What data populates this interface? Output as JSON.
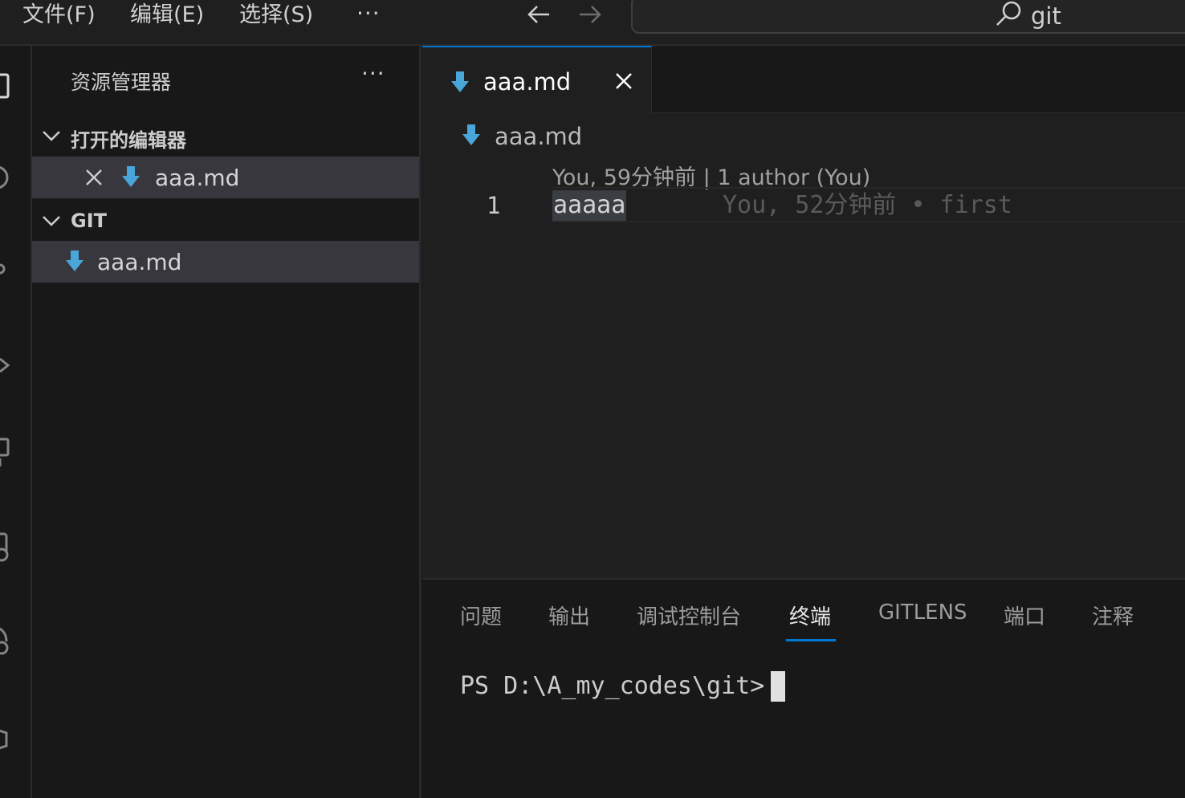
{
  "menu": {
    "file": "文件(F)",
    "edit": "编辑(E)",
    "selection": "选择(S)",
    "more": "···"
  },
  "search": {
    "text": "git",
    "icon": "search-icon"
  },
  "sidebar": {
    "title": "资源管理器",
    "more": "···",
    "open_editors": {
      "label": "打开的编辑器",
      "items": [
        {
          "name": "aaa.md",
          "icon": "markdown-icon"
        }
      ]
    },
    "folder": {
      "label": "GIT",
      "items": [
        {
          "name": "aaa.md",
          "icon": "markdown-icon"
        }
      ]
    }
  },
  "editor": {
    "tab": {
      "name": "aaa.md"
    },
    "breadcrumb": "aaa.md",
    "codelens": "You, 59分钟前 | 1 author (You)",
    "lines": [
      {
        "number": "1",
        "text": "aaaaa",
        "blame": "You, 52分钟前 • first"
      }
    ]
  },
  "panel": {
    "tabs": [
      "问题",
      "输出",
      "调试控制台",
      "终端",
      "GITLENS",
      "端口",
      "注释"
    ],
    "active_tab": "终端",
    "terminal_prompt": "PS D:\\A_my_codes\\git>"
  },
  "colors": {
    "accent": "#0078d4",
    "markdown_icon": "#4aa5d8",
    "background": "#1f1f1f",
    "sidebar_bg": "#181818",
    "selected_row": "#37373d"
  }
}
